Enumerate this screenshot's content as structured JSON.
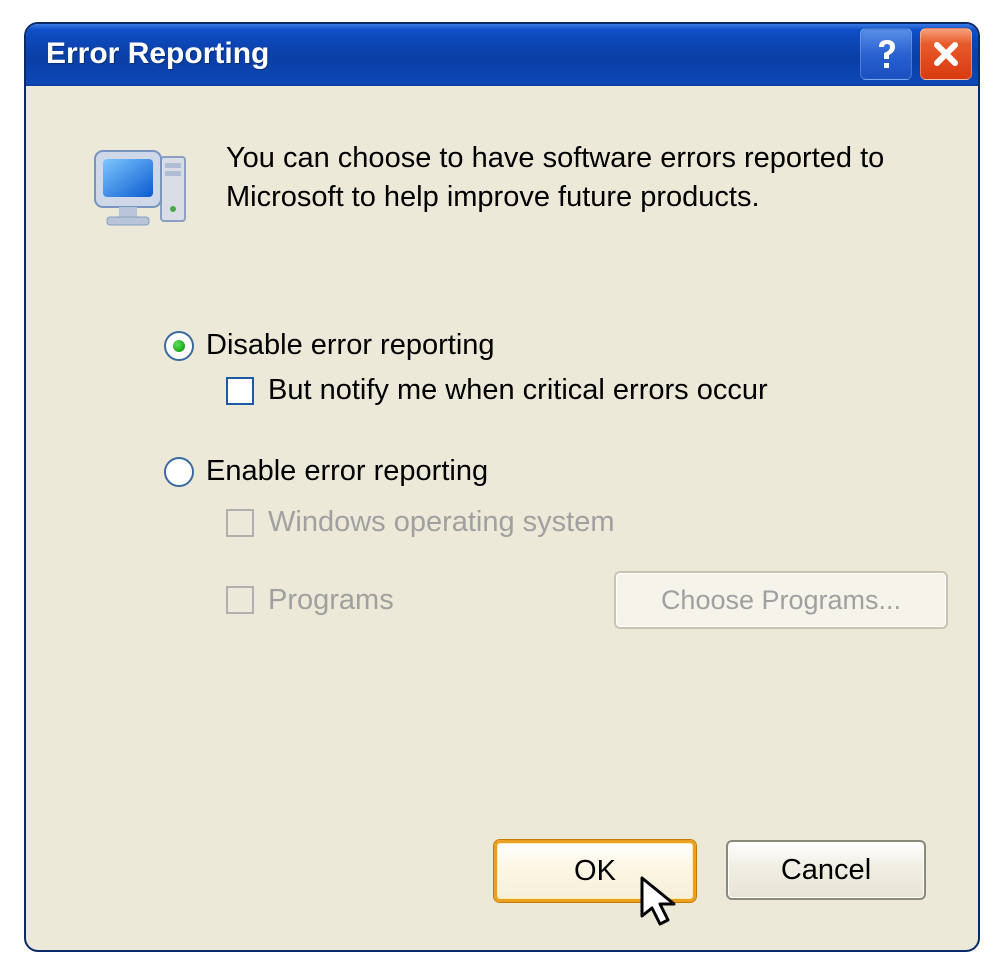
{
  "window": {
    "title": "Error Reporting"
  },
  "intro": "You can choose to have software errors reported to Microsoft to help improve future products.",
  "options": {
    "disable": {
      "label": "Disable error reporting",
      "selected": true,
      "notify_label": "But notify me when critical errors occur",
      "notify_checked": false
    },
    "enable": {
      "label": "Enable error reporting",
      "selected": false,
      "os_label": "Windows operating system",
      "os_checked": false,
      "programs_label": "Programs",
      "programs_checked": false,
      "choose_button": "Choose Programs..."
    }
  },
  "buttons": {
    "ok": "OK",
    "cancel": "Cancel"
  },
  "icons": {
    "help": "help-icon",
    "close": "close-icon",
    "computer": "computer-icon"
  }
}
